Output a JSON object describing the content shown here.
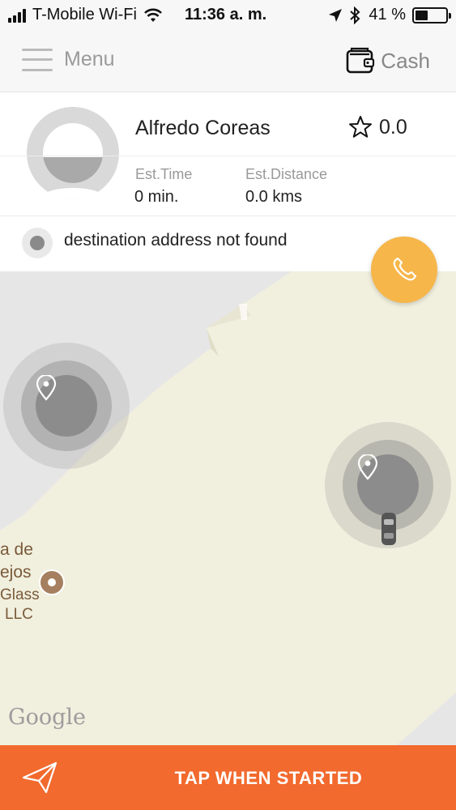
{
  "status_bar": {
    "carrier": "T-Mobile Wi-Fi",
    "time": "11:36 a. m.",
    "battery_percent": "41 %",
    "battery_level": 0.41
  },
  "header": {
    "menu_label": "Menu",
    "payment_label": "Cash"
  },
  "driver": {
    "name": "Alfredo Coreas",
    "rating": "0.0",
    "est_time_label": "Est.Time",
    "est_time_value": "0 min.",
    "est_distance_label": "Est.Distance",
    "est_distance_value": "0.0 kms"
  },
  "destination": {
    "text": "destination address not found"
  },
  "map": {
    "poi_lines": [
      "a de",
      "ejos",
      "Glass",
      "LLC"
    ],
    "attribution": "Google",
    "colors": {
      "land": "#f1efde",
      "road": "#e6e6e6",
      "poi": "#a57f5f"
    }
  },
  "actions": {
    "start_label": "TAP WHEN STARTED",
    "accent_color": "#f26a2e",
    "call_color": "#f6b64a"
  }
}
